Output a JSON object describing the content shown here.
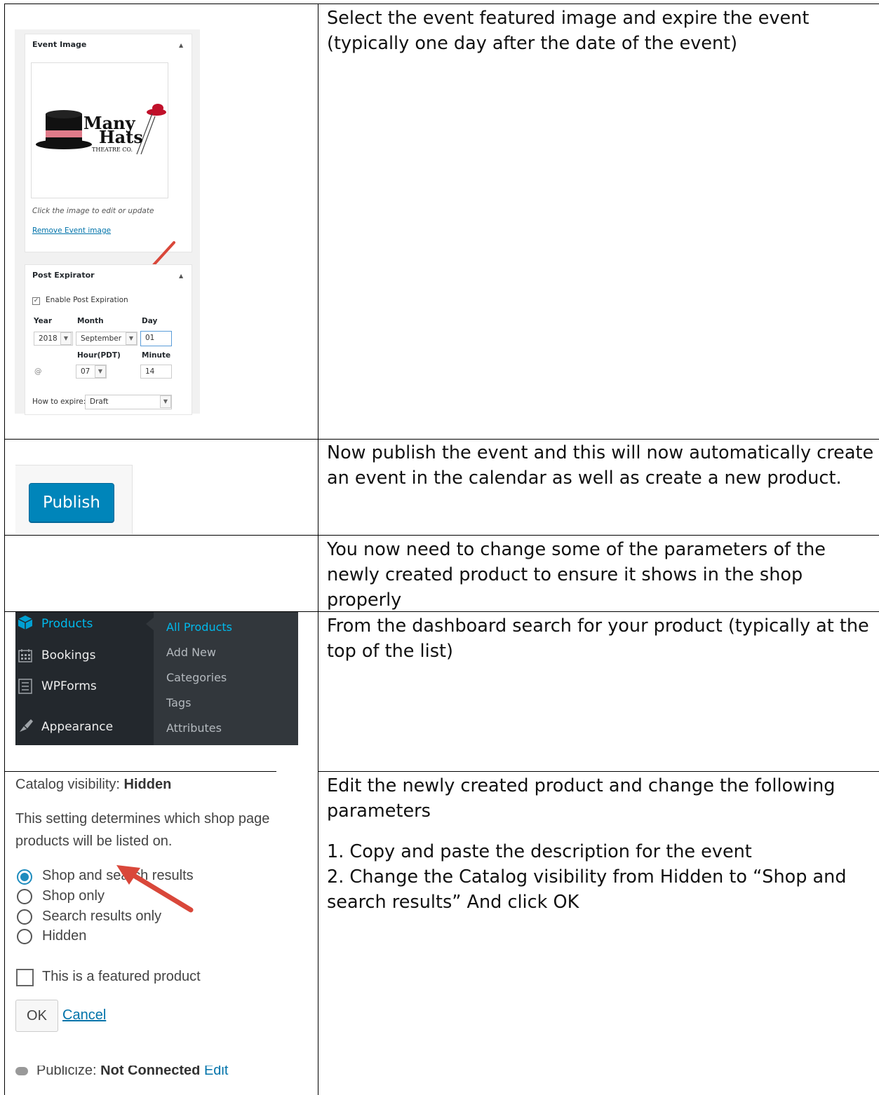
{
  "rows": [
    {
      "text": [
        "Select the event featured image and expire the event (typically one day after the date of the event)"
      ]
    },
    {
      "text": [
        "Now publish the event and this will now automatically create an event in the calendar as well as create a new product."
      ]
    },
    {
      "text": [
        "You now need to change some of the parameters of the newly created product to ensure it shows in the shop properly"
      ]
    },
    {
      "text": [
        "From the dashboard search for your product (typically at the top of the list)"
      ]
    },
    {
      "text": [
        "Edit the newly created product and change the following parameters",
        "",
        "1. Copy and paste the description for the event",
        "2. Change the Catalog visibility from Hidden to “Shop and search results” And click OK"
      ]
    }
  ],
  "event_image": {
    "title": "Event Image",
    "logo_line1": "Many",
    "logo_line2": "Hats",
    "logo_line3": "THEATRE CO.",
    "hint": "Click the image to edit or update",
    "remove_link": "Remove Event image"
  },
  "post_expirator": {
    "title": "Post Expirator",
    "enable_label": "Enable Post Expiration",
    "enabled": true,
    "year_label": "Year",
    "month_label": "Month",
    "day_label": "Day",
    "year": "2018",
    "month": "September",
    "day": "01",
    "hour_label": "Hour(PDT)",
    "minute_label": "Minute",
    "at": "@",
    "hour": "07",
    "minute": "14",
    "how_label": "How to expire:",
    "how_value": "Draft"
  },
  "publish": {
    "label": "Publish"
  },
  "admin_menu": {
    "items": [
      "Products",
      "Bookings",
      "WPForms",
      "Appearance"
    ],
    "submenu": [
      "All Products",
      "Add New",
      "Categories",
      "Tags",
      "Attributes"
    ]
  },
  "catalog": {
    "label": "Catalog visibility:",
    "value": "Hidden",
    "desc_line1": "This setting determines which shop page",
    "desc_line2": "products will be listed on.",
    "options": [
      "Shop and search results",
      "Shop only",
      "Search results only",
      "Hidden"
    ],
    "selected": 0,
    "featured_label": "This is a featured product",
    "ok": "OK",
    "cancel": "Cancel",
    "publicize_label": "Publicize:",
    "publicize_value": "Not Connected",
    "publicize_edit": "Edit"
  }
}
